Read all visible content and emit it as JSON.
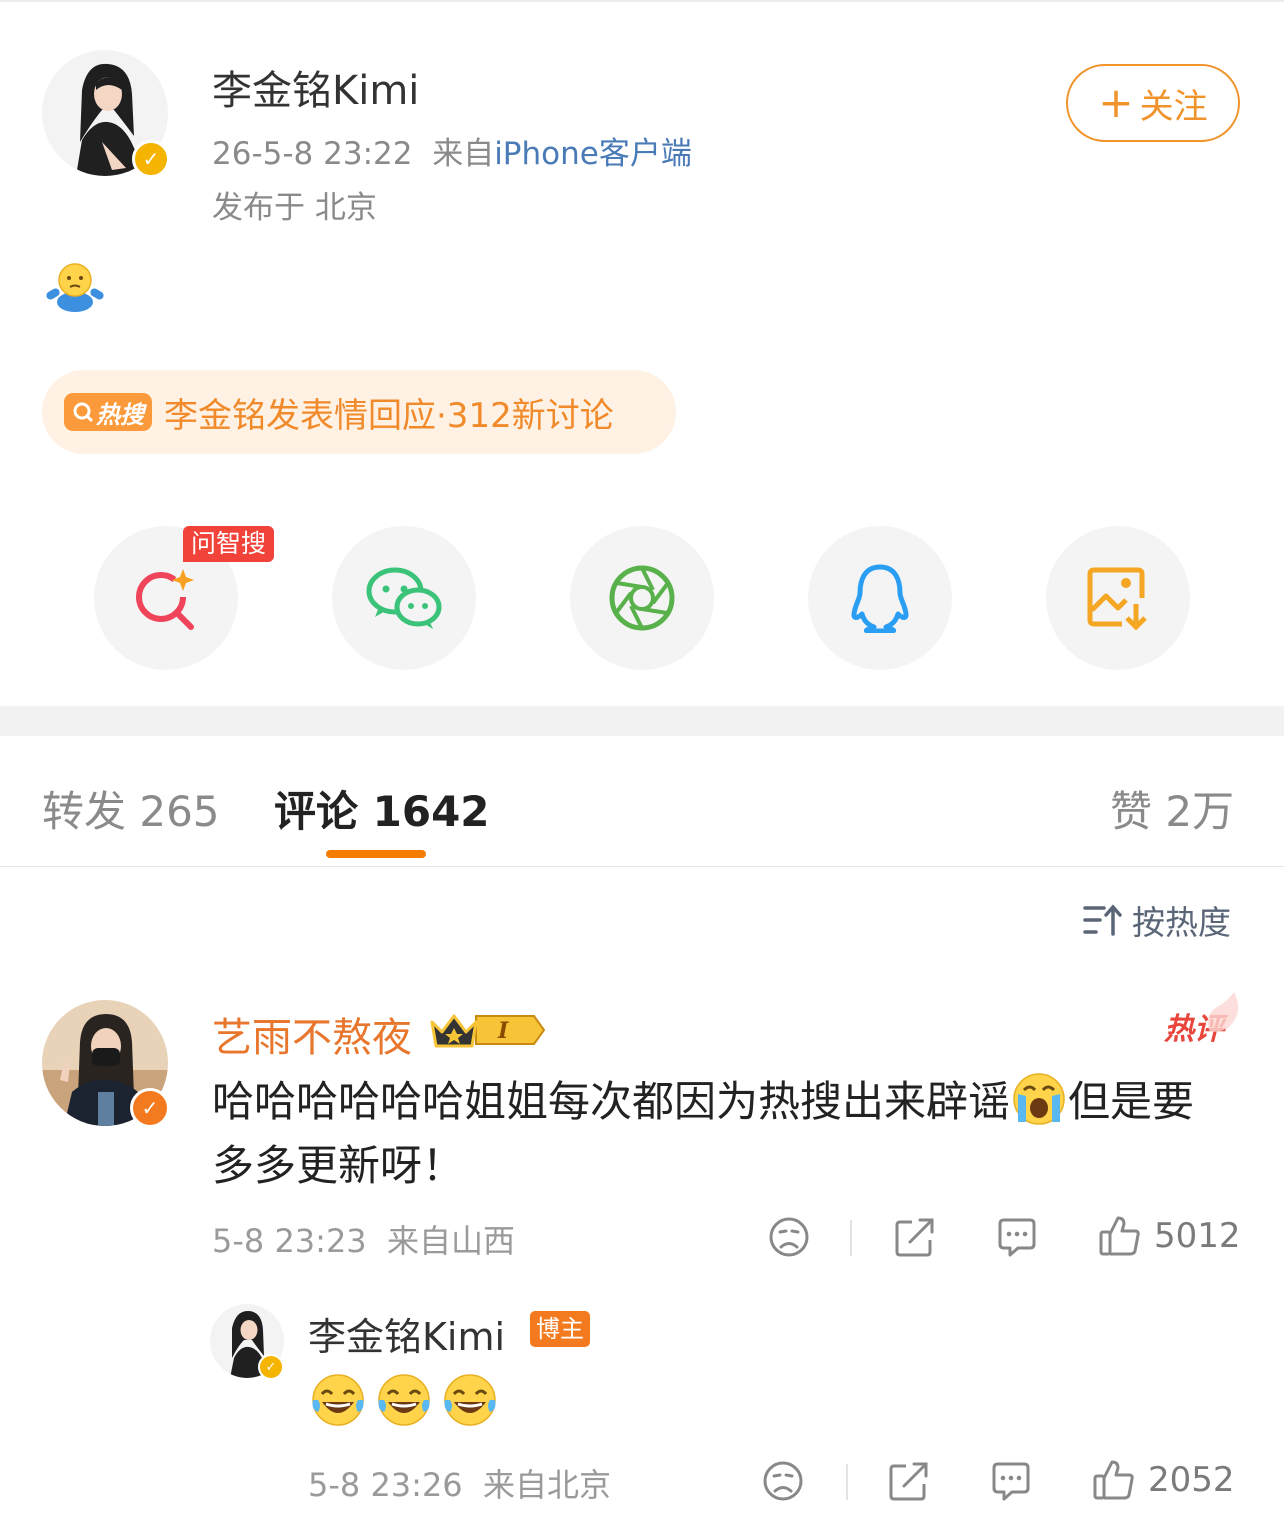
{
  "post": {
    "author": "李金铭Kimi",
    "time": "26-5-8 23:22",
    "source_prefix": "来自",
    "source_client": "iPhone客户端",
    "location": "发布于 北京",
    "follow_label": "关注",
    "follow_plus": "+"
  },
  "hot_search": {
    "tag": "热搜",
    "text": "李金铭发表情回应·312新讨论"
  },
  "share": {
    "ask_badge": "问智搜",
    "items": [
      "ai-search-icon",
      "wechat-icon",
      "moments-icon",
      "qq-icon",
      "save-image-icon"
    ]
  },
  "tabs": {
    "repost": "转发 265",
    "comments": "评论 1642",
    "likes": "赞 2万"
  },
  "sort_label": "按热度",
  "comment": {
    "user": "艺雨不熬夜",
    "level": "I",
    "hot_label": "热评",
    "text_before": "哈哈哈哈哈哈姐姐每次都因为热搜出来辟谣",
    "text_after": "但是要多多更新呀！",
    "time": "5-8 23:23",
    "location": "来自山西",
    "likes": "5012"
  },
  "reply": {
    "user": "李金铭Kimi",
    "badge": "博主",
    "time": "5-8 23:26",
    "location": "来自北京",
    "likes": "2052"
  },
  "colors": {
    "accent": "#f57c00",
    "follow": "#f0932b",
    "verified": "#f5b400",
    "hot": "#e8463c"
  }
}
